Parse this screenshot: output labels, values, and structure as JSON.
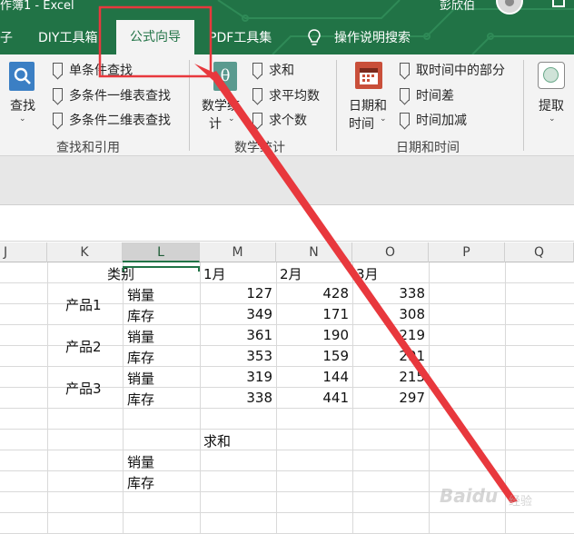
{
  "title_bar": {
    "doc_title": "作簿1  -  Excel",
    "user": "彭欣伯"
  },
  "tabs": [
    "子",
    "DIY工具箱",
    "公式向导",
    "PDF工具集",
    "操作说明搜索"
  ],
  "ribbon": {
    "find_group": {
      "big_button": "查找",
      "items": [
        "单条件查找",
        "多条件一维表查找",
        "多条件二维表查找"
      ],
      "label": "查找和引用"
    },
    "math_group": {
      "big_button_line1": "数学统",
      "big_button_line2": "计",
      "items": [
        "求和",
        "求平均数",
        "求个数"
      ],
      "label": "数学统计"
    },
    "date_group": {
      "big_button_line1": "日期和",
      "big_button_line2": "时间",
      "items": [
        "取时间中的部分",
        "时间差",
        "时间加减"
      ],
      "label": "日期和时间"
    },
    "extract_group": {
      "big_button": "提取"
    }
  },
  "columns": [
    "J",
    "K",
    "L",
    "M",
    "N",
    "O",
    "P",
    "Q"
  ],
  "table": {
    "header_category": "类别",
    "months": [
      "1月",
      "2月",
      "3月"
    ],
    "products": [
      "产品1",
      "产品2",
      "产品3"
    ],
    "row_labels": [
      "销量",
      "库存",
      "销量",
      "库存",
      "销量",
      "库存"
    ],
    "values": [
      [
        127,
        428,
        338
      ],
      [
        349,
        171,
        308
      ],
      [
        361,
        190,
        219
      ],
      [
        353,
        159,
        291
      ],
      [
        319,
        144,
        215
      ],
      [
        338,
        441,
        297
      ]
    ],
    "sum_label": "求和",
    "sum_rows": [
      "销量",
      "库存"
    ]
  },
  "colors": {
    "excel_green": "#217346",
    "annotation_red": "#e8383d"
  },
  "watermark": {
    "text": "Baidu",
    "sub": "经验"
  }
}
